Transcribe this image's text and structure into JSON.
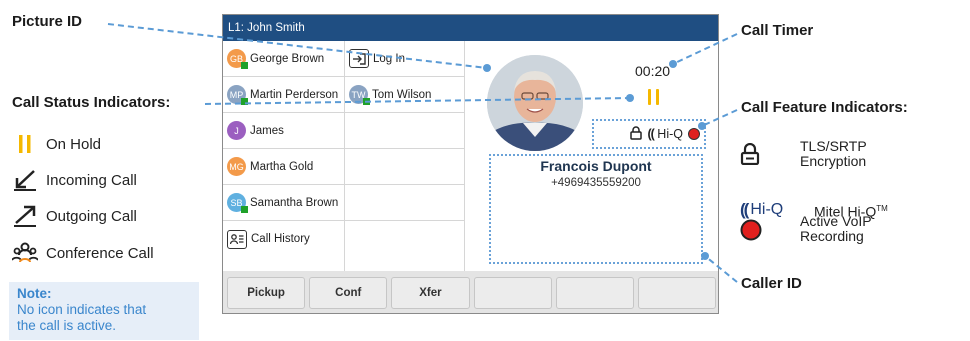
{
  "callouts": {
    "picture_id": "Picture ID",
    "call_status": "Call Status Indicators:",
    "call_timer": "Call Timer",
    "call_feature": "Call Feature Indicators:",
    "caller_id": "Caller ID"
  },
  "status_legend": [
    {
      "icon": "on-hold-icon",
      "label": "On Hold"
    },
    {
      "icon": "incoming-call-icon",
      "label": "Incoming Call"
    },
    {
      "icon": "outgoing-call-icon",
      "label": "Outgoing Call"
    },
    {
      "icon": "conference-call-icon",
      "label": "Conference Call"
    }
  ],
  "note": {
    "title": "Note:",
    "line1": "No icon indicates that",
    "line2": "the call is active."
  },
  "feature_legend": {
    "tls": {
      "label1": "TLS/SRTP",
      "label2": "Encryption"
    },
    "hiq": {
      "icon_text": "Hi-Q",
      "label": "Mitel Hi-Q",
      "tm": "TM"
    },
    "rec": {
      "label1": "Active VoIP",
      "label2": "Recording"
    }
  },
  "phone": {
    "title": "L1: John Smith",
    "col1": [
      {
        "initials": "GB",
        "name": "George Brown",
        "color": "#f39a4a",
        "presence": true
      },
      {
        "initials": "MP",
        "name": "Martin Perderson",
        "color": "#8aa3c2",
        "presence": true
      },
      {
        "initials": "J",
        "name": "James",
        "color": "#9b5fc0",
        "presence": false
      },
      {
        "initials": "MG",
        "name": "Martha Gold",
        "color": "#f39a4a",
        "presence": false
      },
      {
        "initials": "SB",
        "name": "Samantha Brown",
        "color": "#5fb0e0",
        "presence": true
      }
    ],
    "call_history": "Call History",
    "col2": {
      "login": "Log In",
      "contact": {
        "initials": "TW",
        "name": "Tom Wilson",
        "color": "#8aa3c2",
        "presence": true
      }
    },
    "timer": "00:20",
    "hiq_text": "Hi-Q",
    "caller_name": "Francois Dupont",
    "caller_number": "+4969435559200",
    "softkeys": [
      "Pickup",
      "Conf",
      "Xfer",
      "",
      "",
      ""
    ]
  },
  "colors": {
    "accent_blue": "#1f4e82",
    "callout_line": "#5b9bd5",
    "hold_yellow": "#f5b800",
    "record_red": "#e0201e"
  }
}
